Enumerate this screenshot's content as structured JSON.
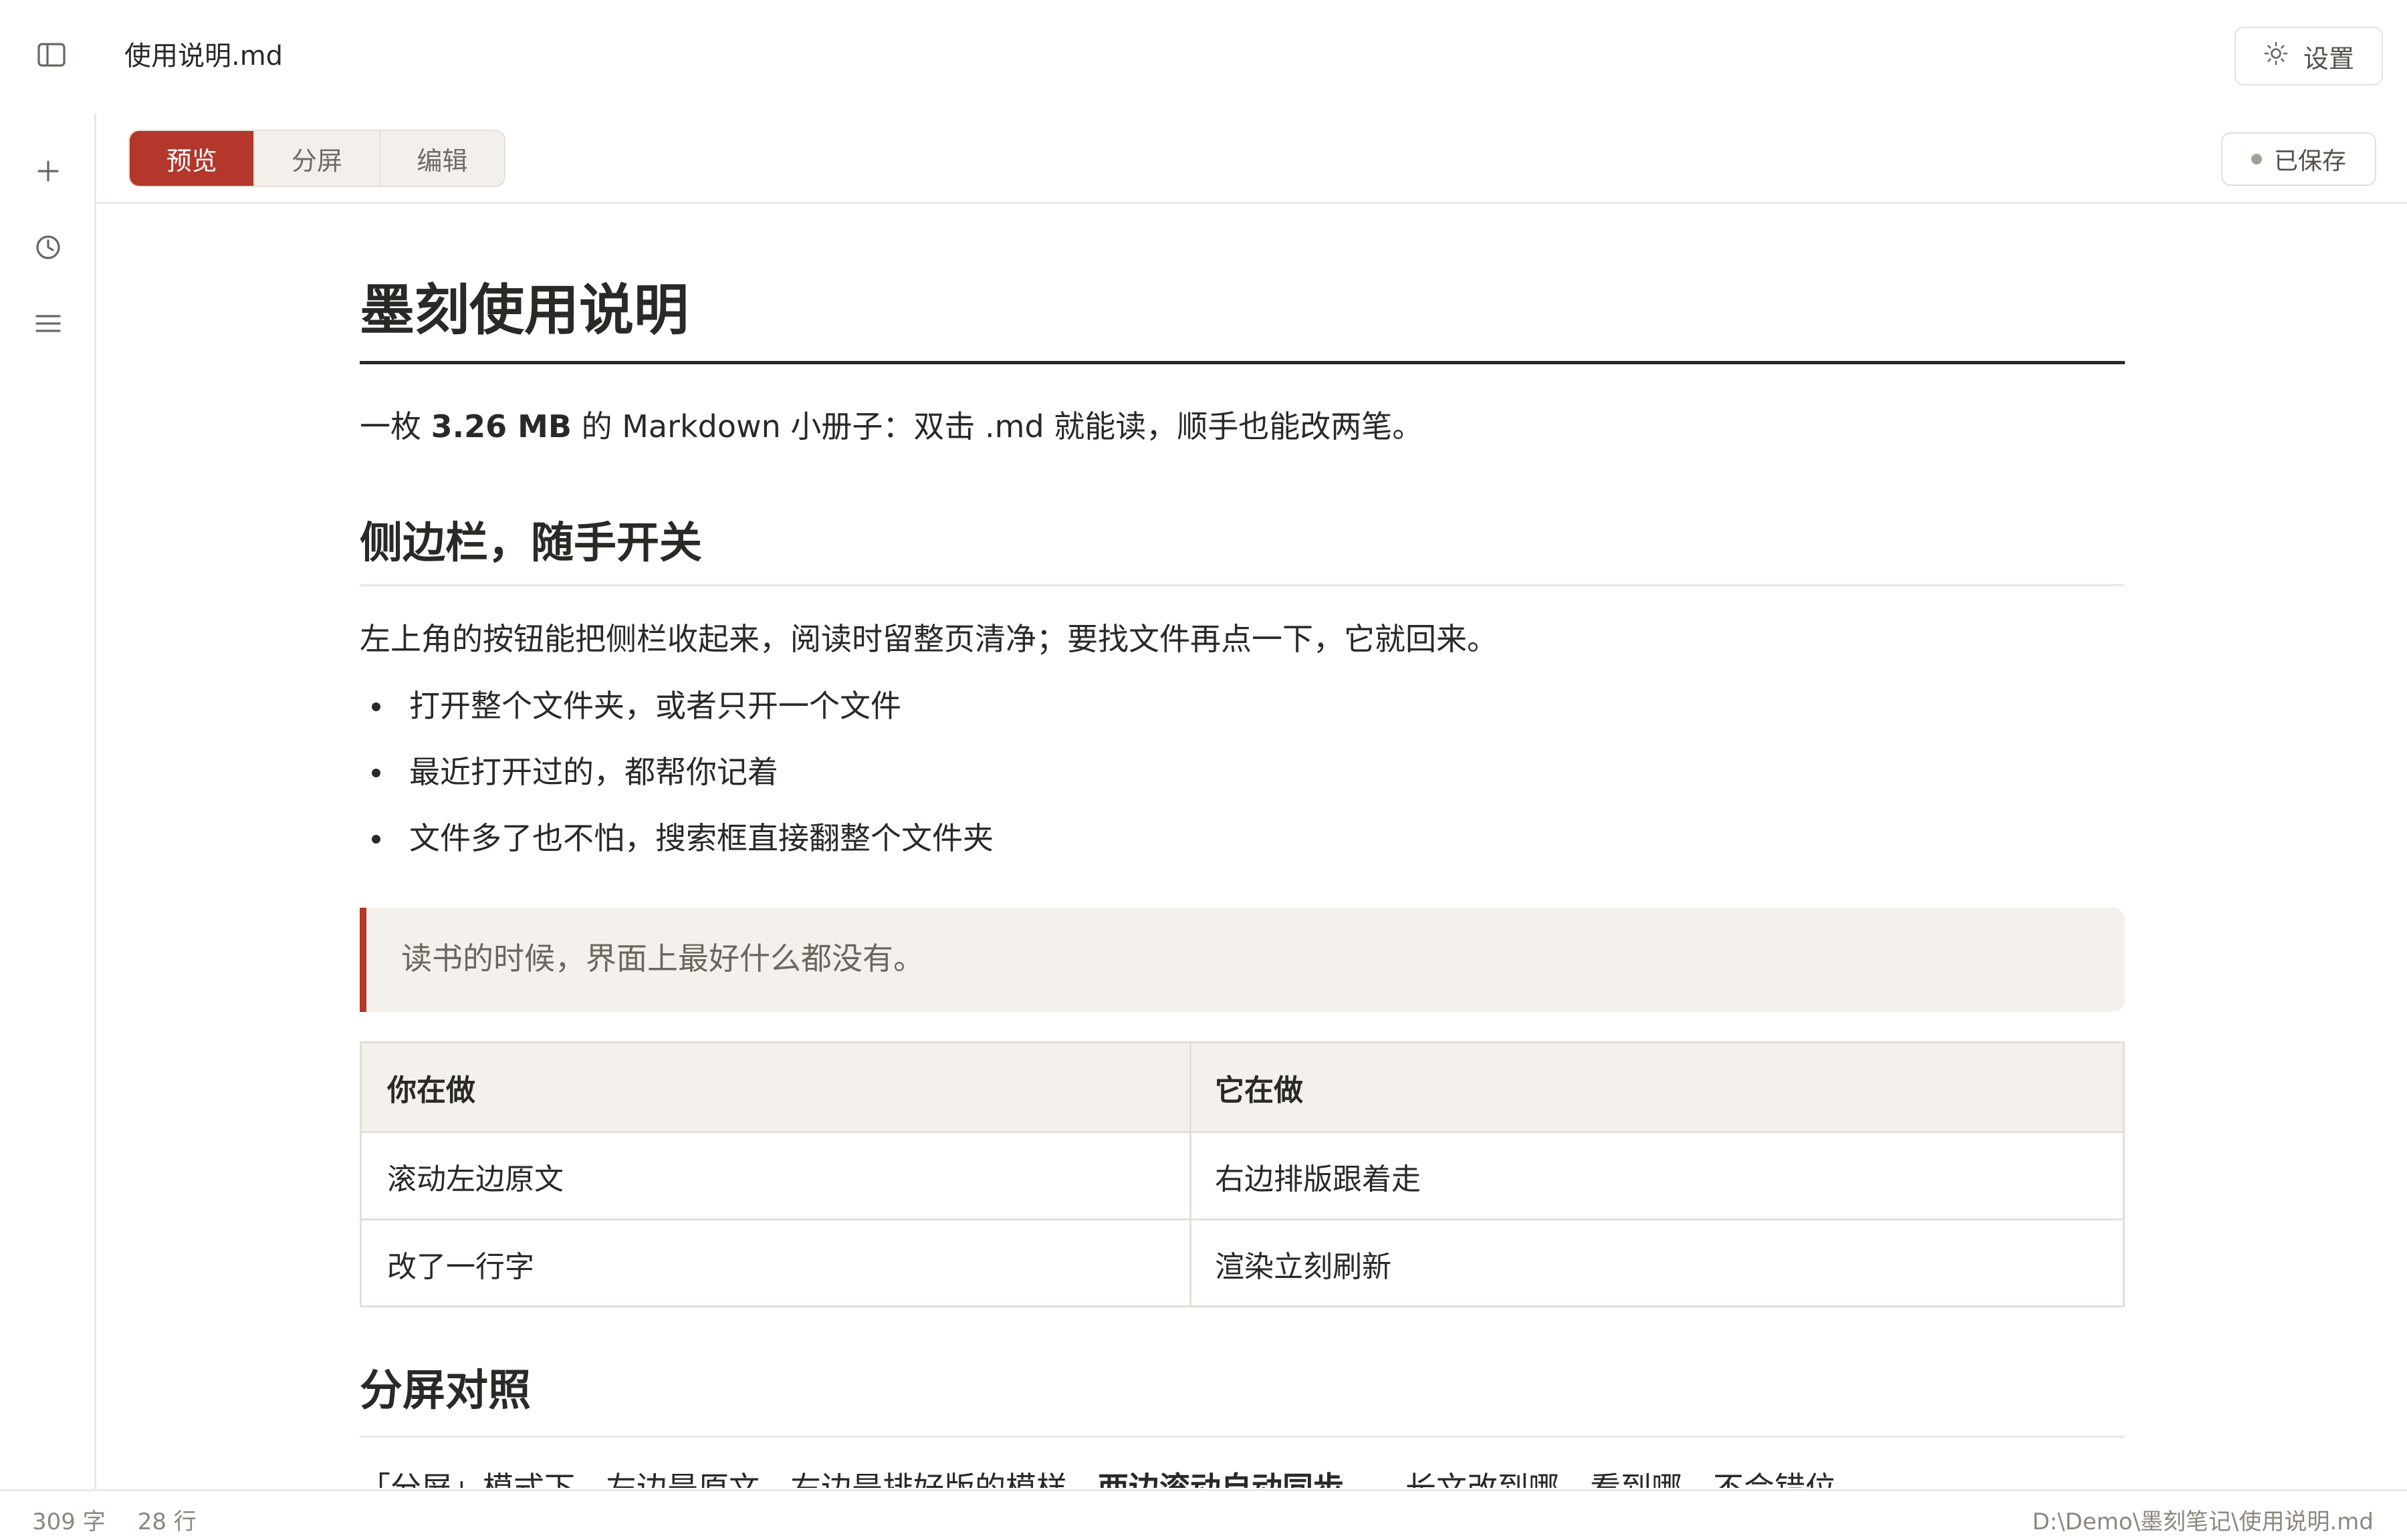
{
  "window": {
    "file_name": "使用说明.md",
    "settings_label": "设置"
  },
  "icons": {
    "sidebar_toggle": "sidebar-icon",
    "new_file": "plus-icon",
    "recent": "clock-icon",
    "outline": "menu-icon",
    "settings": "sun-gear-icon"
  },
  "toolbar": {
    "tabs": [
      {
        "label": "预览",
        "active": true
      },
      {
        "label": "分屏",
        "active": false
      },
      {
        "label": "编辑",
        "active": false
      }
    ],
    "saved_label": "已保存"
  },
  "doc": {
    "title": "墨刻使用说明",
    "lead": {
      "before": "一枚 ",
      "bold": "3.26 MB",
      "after": " 的 Markdown 小册子：双击 .md 就能读，顺手也能改两笔。"
    },
    "section1": {
      "heading": "侧边栏，随手开关",
      "paragraph": "左上角的按钮能把侧栏收起来，阅读时留整页清净；要找文件再点一下，它就回来。",
      "bullets": [
        "打开整个文件夹，或者只开一个文件",
        "最近打开过的，都帮你记着",
        "文件多了也不怕，搜索框直接翻整个文件夹"
      ],
      "quote": "读书的时候，界面上最好什么都没有。",
      "table": {
        "headers": [
          "你在做",
          "它在做"
        ],
        "rows": [
          [
            "滚动左边原文",
            "右边排版跟着走"
          ],
          [
            "改了一行字",
            "渲染立刻刷新"
          ]
        ]
      }
    },
    "section2": {
      "heading": "分屏对照",
      "paragraph_before": "「分屏」模式下，左边是原文，右边是排好版的模样，",
      "paragraph_bold": "两边滚动自动同步",
      "paragraph_after": "——长文改到哪，看到哪，不会错位。"
    }
  },
  "status": {
    "word_count": "309 字",
    "line_count": "28 行",
    "path": "D:\\Demo\\墨刻笔记\\使用说明.md"
  },
  "colors": {
    "accent": "#b3372b",
    "text": "#2b2926",
    "muted": "#8c877f",
    "quote_bg": "#f4f1ec",
    "border": "#e3ded7"
  }
}
